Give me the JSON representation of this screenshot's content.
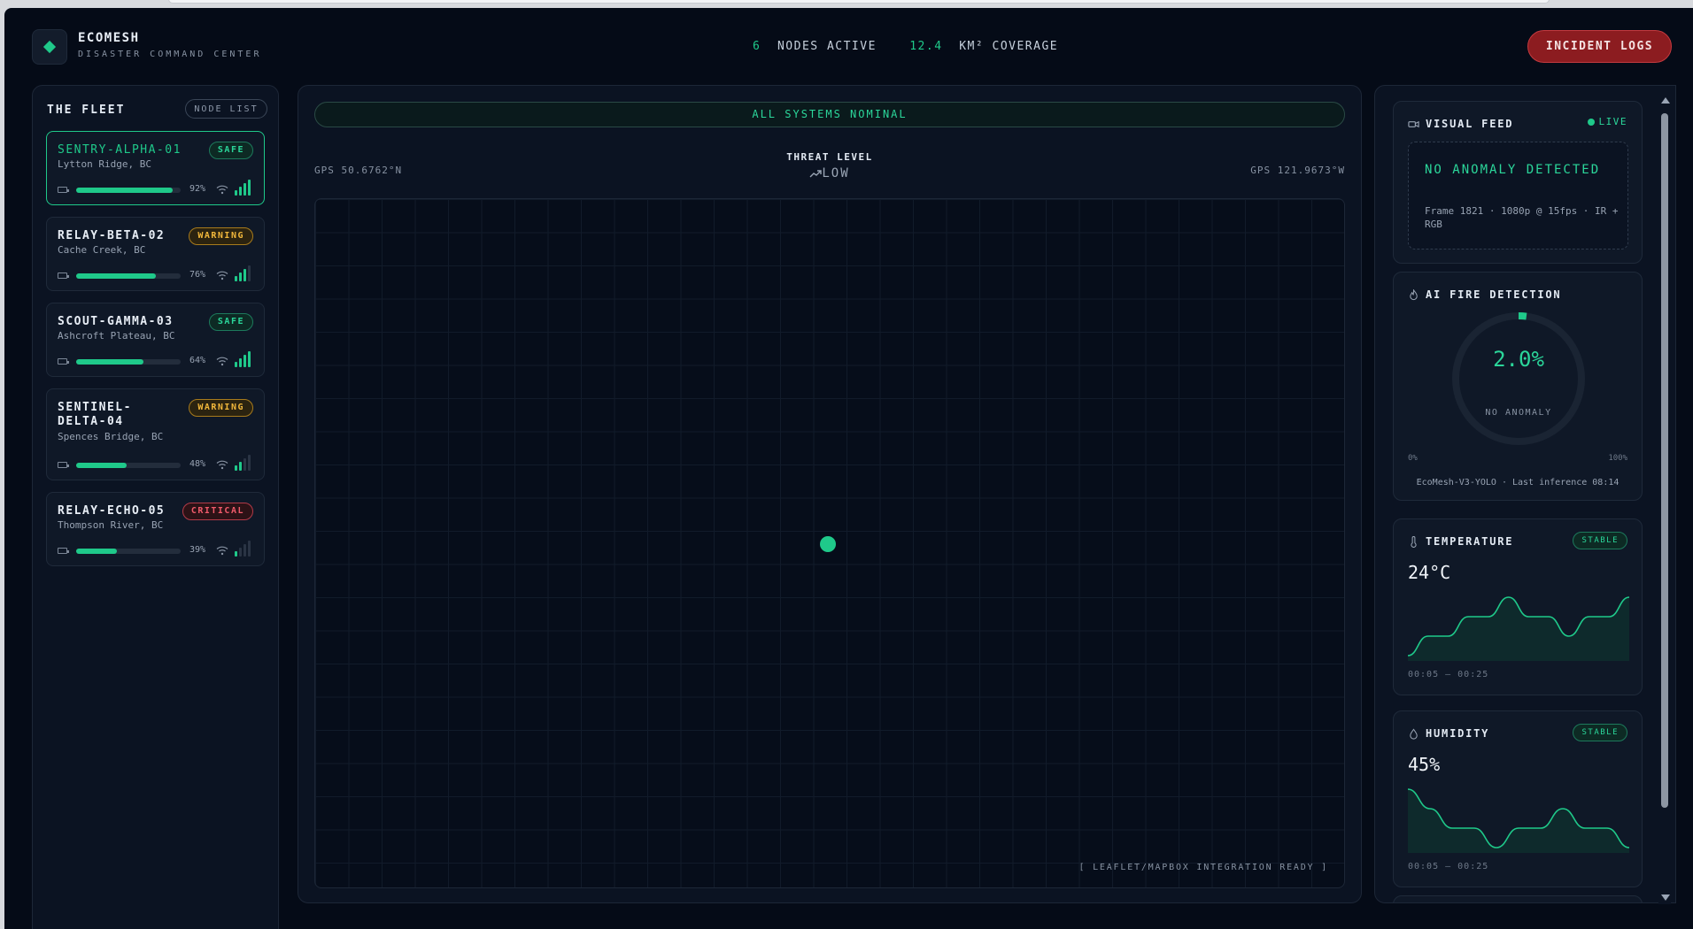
{
  "header": {
    "brand_name": "ECOMESH",
    "brand_sub": "DISASTER COMMAND CENTER",
    "nodes_active_value": "6",
    "nodes_active_label": "NODES ACTIVE",
    "coverage_value": "12.4",
    "coverage_label": "KM² COVERAGE",
    "incident_logs_label": "INCIDENT LOGS"
  },
  "fleet": {
    "title": "THE FLEET",
    "node_list_label": "NODE LIST",
    "nodes": [
      {
        "name": "SENTRY-ALPHA-01",
        "location": "Lytton Ridge, BC",
        "status": "SAFE",
        "battery_pct": 92,
        "battery_label": "92%",
        "signal_bars": 4
      },
      {
        "name": "RELAY-BETA-02",
        "location": "Cache Creek, BC",
        "status": "WARNING",
        "battery_pct": 76,
        "battery_label": "76%",
        "signal_bars": 3
      },
      {
        "name": "SCOUT-GAMMA-03",
        "location": "Ashcroft Plateau, BC",
        "status": "SAFE",
        "battery_pct": 64,
        "battery_label": "64%",
        "signal_bars": 4
      },
      {
        "name": "SENTINEL-DELTA-04",
        "location": "Spences Bridge, BC",
        "status": "WARNING",
        "battery_pct": 48,
        "battery_label": "48%",
        "signal_bars": 2
      },
      {
        "name": "RELAY-ECHO-05",
        "location": "Thompson River, BC",
        "status": "CRITICAL",
        "battery_pct": 39,
        "battery_label": "39%",
        "signal_bars": 1
      }
    ]
  },
  "map": {
    "status_banner": "ALL SYSTEMS NOMINAL",
    "gps_lat": "GPS 50.6762°N",
    "gps_lon": "GPS 121.9673°W",
    "threat_label": "THREAT LEVEL",
    "threat_value": "LOW",
    "footer": "[ LEAFLET/MAPBOX INTEGRATION READY ]"
  },
  "visual_feed": {
    "title": "VISUAL FEED",
    "live_label": "LIVE",
    "status": "NO ANOMALY DETECTED",
    "meta": "Frame 1821 · 1080p @ 15fps · IR + RGB"
  },
  "fire_detection": {
    "title": "AI FIRE DETECTION",
    "value_pct": 2.0,
    "value_label": "2.0%",
    "sub_label": "NO ANOMALY",
    "min_label": "0%",
    "max_label": "100%",
    "model_line": "EcoMesh-V3-YOLO · Last inference 08:14"
  },
  "temperature": {
    "title": "TEMPERATURE",
    "status": "STABLE",
    "reading": "24°C",
    "range": "00:05 — 00:25",
    "trend": [
      0,
      1.0,
      1.0,
      2.0,
      2.0,
      3.0,
      2.0,
      2.0,
      1.0,
      2.0,
      2.0,
      3.0
    ]
  },
  "humidity": {
    "title": "HUMIDITY",
    "status": "STABLE",
    "reading": "45%",
    "range": "00:05 — 00:25",
    "trend": [
      3.0,
      2.0,
      1.0,
      1.0,
      0,
      1.0,
      1.0,
      2.0,
      1.0,
      1.0,
      0
    ]
  },
  "colors": {
    "accent": "#1fc98a",
    "warning": "#f1b73b",
    "critical": "#ef5a6a",
    "danger_button": "#8c1c20"
  }
}
